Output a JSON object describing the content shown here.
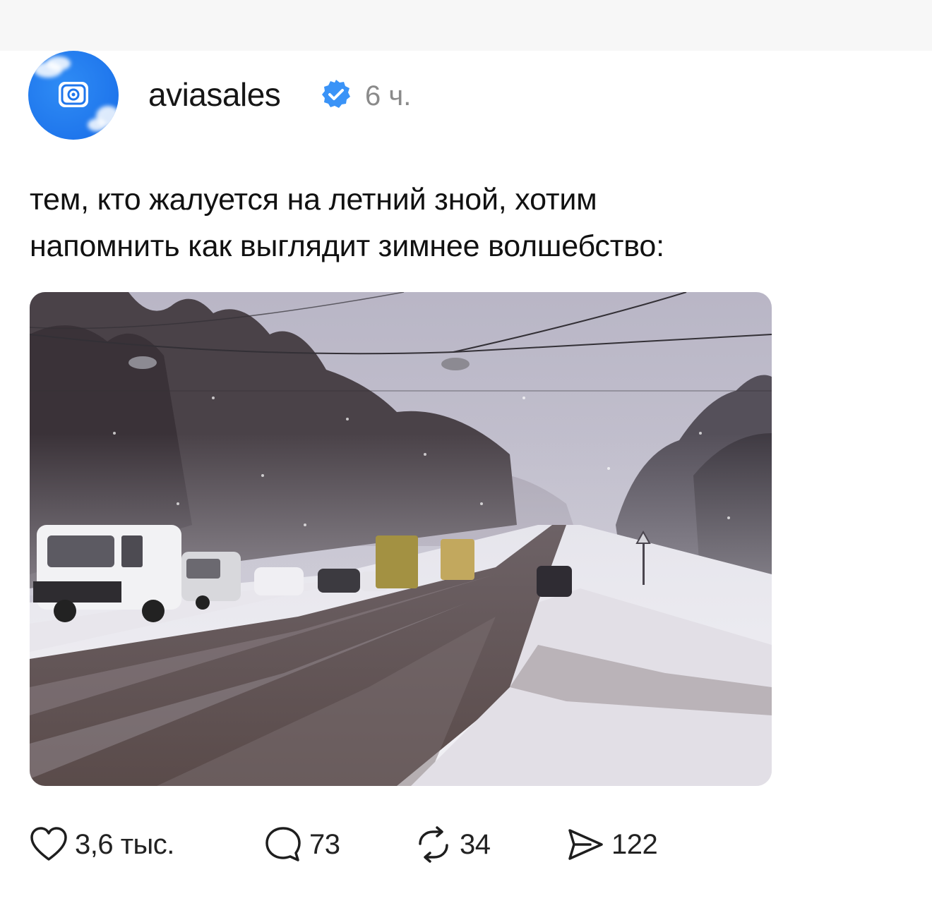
{
  "post": {
    "author": {
      "username": "aviasales",
      "verified": true,
      "time": "6 ч."
    },
    "text_line1": "тем, кто жалуется на летний зной, хотим",
    "text_line2": "напомнить как выглядит зимнее волшебство:",
    "image": {
      "description_icon": "snowy-road-photo"
    },
    "actions": {
      "likes": "3,6 тыс.",
      "comments": "73",
      "reposts": "34",
      "shares": "122"
    }
  },
  "colors": {
    "avatar_blue": "#1f76ec",
    "verified_blue": "#3a93f7",
    "time_gray": "#8a8a8a"
  },
  "icons": {
    "like": "heart-icon",
    "comment": "comment-bubble-icon",
    "repost": "repost-arrows-icon",
    "share": "paper-plane-icon",
    "verified": "verified-badge-icon"
  }
}
